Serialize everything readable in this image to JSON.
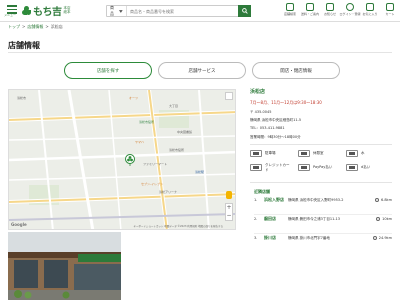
{
  "header": {
    "menu_label": "メニュー",
    "logo_text": "もち吉",
    "logo_sub": "本店 総本",
    "search": {
      "category": "商品",
      "placeholder": "商品名・商品番号を検索"
    },
    "icons": [
      {
        "name": "store-icon",
        "label": "店舗検索"
      },
      {
        "name": "shipping-icon",
        "label": "送料・ご案内"
      },
      {
        "name": "bell-icon",
        "label": "お知らせ"
      },
      {
        "name": "user-icon",
        "label": "ログイン・登録"
      },
      {
        "name": "heart-icon",
        "label": "お気に入り"
      },
      {
        "name": "cart-icon",
        "label": "カート"
      }
    ]
  },
  "breadcrumb": {
    "items": [
      "トップ",
      "店舗情報",
      "浜松店"
    ],
    "separator": ">"
  },
  "page_title": "店舗情報",
  "tabs": [
    {
      "label": "店舗を探す",
      "active": true
    },
    {
      "label": "店舗サービス",
      "active": false
    },
    {
      "label": "開店・閉店情報",
      "active": false
    }
  ],
  "map": {
    "labels": [
      {
        "text": "浜松市",
        "cls": ""
      },
      {
        "text": "オーツ",
        "cls": "orange"
      },
      {
        "text": "大丁目",
        "cls": ""
      },
      {
        "text": "中央図書館",
        "cls": ""
      },
      {
        "text": "浜松市役所",
        "cls": "green"
      },
      {
        "text": "ヤマハ",
        "cls": "orange"
      },
      {
        "text": "浜松市役所",
        "cls": ""
      },
      {
        "text": "ファミリーマート",
        "cls": ""
      },
      {
        "text": "浜松駅",
        "cls": "blue"
      },
      {
        "text": "セブン-イレブン",
        "cls": "orange"
      },
      {
        "text": "浜松アリーナ",
        "cls": ""
      }
    ],
    "zoom_in": "+",
    "zoom_out": "−",
    "google": "Google",
    "footer": "キーボードショートカット 地図データ ©2023 利用規約 地図の誤りを報告する"
  },
  "store": {
    "name": "浜松店",
    "hours_notice": "7月～8月、11月～12月は9:30～18:30",
    "postal": "〒 435-0045",
    "address": "静岡県 浜松市中央区細島町11-5",
    "tel": "TEL：053-411-9881",
    "hours": "営業時間：9時30分～18時00分"
  },
  "services": [
    {
      "label": "駐車場",
      "icon": "parking-icon"
    },
    {
      "label": "休憩室",
      "icon": "rest-icon"
    },
    {
      "label": "水",
      "icon": "water-icon"
    },
    {
      "label": "クレジットカード",
      "icon": "card-icon"
    },
    {
      "label": "PayPay払い",
      "icon": "paypay-icon"
    },
    {
      "label": "d払い",
      "icon": "dpay-icon"
    }
  ],
  "nearby": {
    "title": "近隣店舗",
    "stores": [
      {
        "num": "1.",
        "name": "浜松入野店",
        "addr": "静岡県 浜松市中央区入野町9953-2",
        "dist": "6.8km"
      },
      {
        "num": "2.",
        "name": "磐田店",
        "addr": "静岡県 磐田市今之浦3丁目11-13",
        "dist": "10km"
      },
      {
        "num": "3.",
        "name": "掛川店",
        "addr": "静岡県 掛川市北門宇7番地",
        "dist": "24.9km"
      }
    ]
  },
  "colors": {
    "brand": "#2d7a3a",
    "accent_red": "#c0392b"
  }
}
